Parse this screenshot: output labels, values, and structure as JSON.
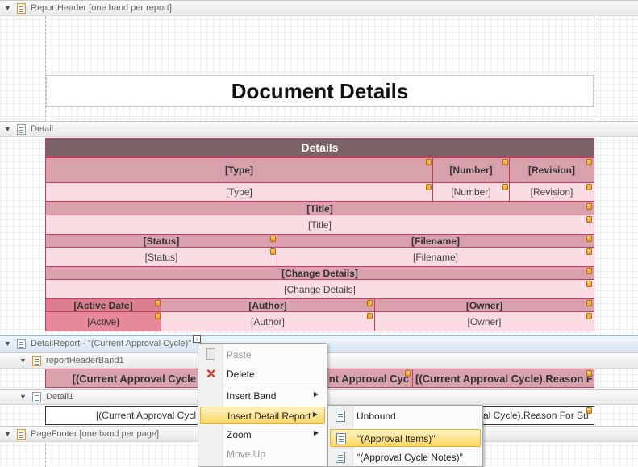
{
  "bands": {
    "report_header": "ReportHeader [one band per report]",
    "detail": "Detail",
    "detail_report": "DetailReport - \"(Current Approval Cycle)\"",
    "report_header_band1": "reportHeaderBand1",
    "detail1": "Detail1",
    "page_footer": "PageFooter [one band per page]"
  },
  "report": {
    "title": "Document Details",
    "details_header": "Details",
    "type_label": "[Type]",
    "number_label": "[Number]",
    "revision_label": "[Revision]",
    "type_value": "[Type]",
    "number_value": "[Number]",
    "revision_value": "[Revision]",
    "title_label": "[Title]",
    "title_value": "[Title]",
    "status_label": "[Status]",
    "filename_label": "[Filename]",
    "status_value": "[Status]",
    "filename_value": "[Filename]",
    "change_label": "[Change Details]",
    "change_value": "[Change Details]",
    "active_date_label": "[Active Date]",
    "author_label": "[Author]",
    "owner_label": "[Owner]",
    "active_value": "[Active]",
    "author_value": "[Author]",
    "owner_value": "[Owner]"
  },
  "approval": {
    "header1": "[(Current Approval Cycle",
    "header2": "nt Approval Cyc",
    "header3": "[(Current Approval Cycle).Reason F",
    "detail1": "[(Current Approval Cycl",
    "detail3": "al Cycle).Reason For Su"
  },
  "context_menu": {
    "paste": "Paste",
    "delete": "Delete",
    "insert_band": "Insert Band",
    "insert_detail_report": "Insert Detail Report",
    "zoom": "Zoom",
    "move_up": "Move Up"
  },
  "submenu": {
    "unbound": "Unbound",
    "approval_items": "\"(Approval Items)\"",
    "approval_cycle_notes": "\"(Approval Cycle Notes)\""
  },
  "icons": {
    "expand": "expand-triangle-icon",
    "band": "band-icon",
    "paste": "paste-icon",
    "delete": "delete-x-icon",
    "smart_tag": "smart-tag-icon"
  }
}
